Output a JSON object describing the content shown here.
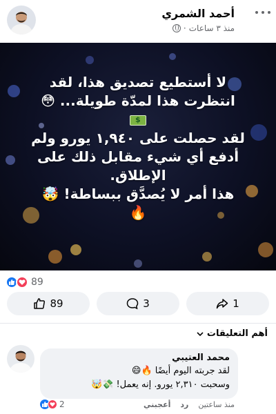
{
  "post": {
    "author_name": "أحمد الشمري",
    "time": "منذ ٣ ساعات",
    "separator": "·",
    "text_lines": [
      "لا أستطيع تصديق هذا، لقد",
      "انتظرت هذا لمدّة طويلة... 😳",
      "لقد حصلت على ١,٩٤٠ يورو ولم",
      "أدفع أي شيء مقابل ذلك على",
      "الإطلاق.",
      "هذا أمر لا يُصدَّق ببساطة! 🤯",
      "🔥"
    ]
  },
  "reactions": {
    "count": "89",
    "icons": [
      "like-icon",
      "heart-icon"
    ]
  },
  "actions": {
    "like_count": "89",
    "comment_count": "3",
    "share_count": "1"
  },
  "comments": {
    "sort_label": "أهم التعليقات",
    "items": [
      {
        "author": "محمد العتيبي",
        "text_line1": "لقد جربته اليوم أيضًا 🔥😄",
        "text_line2": "وسحبت ٢,٣١٠ يورو. إنه يعمل! 💸🤯",
        "like_label": "أعجبني",
        "reply_label": "رد",
        "time": "منذ ساعتين",
        "reaction_count": "2"
      }
    ]
  },
  "colors": {
    "brand_blue": "#1877f2",
    "heart_red": "#f33e58",
    "pill_bg": "#f0f2f5",
    "meta_gray": "#65676b"
  }
}
